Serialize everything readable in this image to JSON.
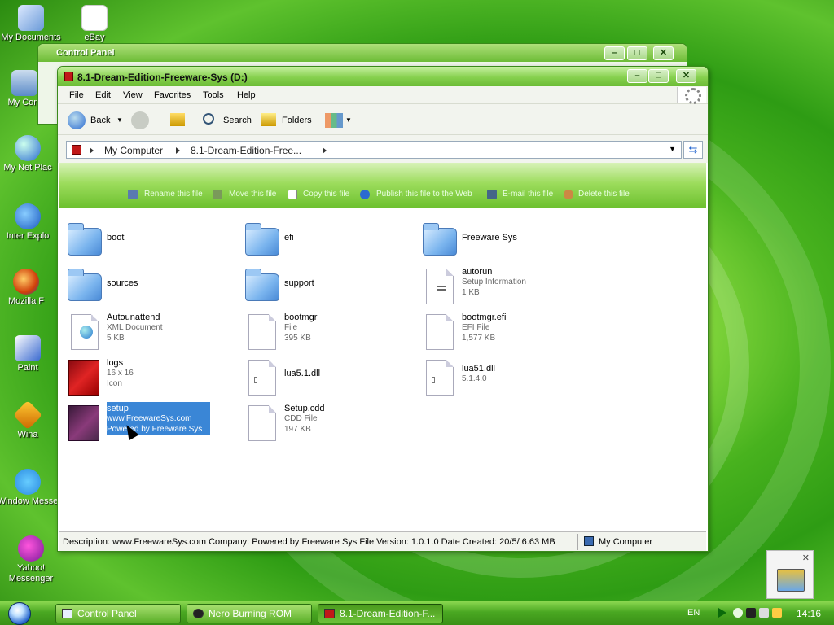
{
  "desktop": {
    "icons": [
      {
        "label": "My Documents"
      },
      {
        "label": "eBay"
      },
      {
        "label": "My Com"
      },
      {
        "label": "My Net Plac"
      },
      {
        "label": "Inter Explo"
      },
      {
        "label": "Mozilla F"
      },
      {
        "label": "Paint"
      },
      {
        "label": "Wina"
      },
      {
        "label": "Window Messe"
      },
      {
        "label": "Yahoo! Messenger"
      }
    ]
  },
  "back_window": {
    "title": "Control Panel"
  },
  "window": {
    "title": "8.1-Dream-Edition-Freeware-Sys (D:)",
    "caption": {
      "minimize": "0",
      "maximize": "1",
      "close": "r"
    },
    "menu": [
      "File",
      "Edit",
      "View",
      "Favorites",
      "Tools",
      "Help"
    ],
    "toolbar": {
      "back": "Back",
      "search": "Search",
      "folders": "Folders"
    },
    "address": {
      "crumbs": [
        "My Computer",
        "8.1-Dream-Edition-Free..."
      ]
    },
    "commands": [
      "Rename this file",
      "Move this file",
      "Copy this file",
      "Publish this file to the Web",
      "E-mail this file",
      "Delete this file"
    ],
    "files": [
      {
        "name": "boot",
        "kind": "folder"
      },
      {
        "name": "efi",
        "kind": "folder"
      },
      {
        "name": "Freeware Sys",
        "kind": "folder"
      },
      {
        "name": "sources",
        "kind": "folder"
      },
      {
        "name": "support",
        "kind": "folder"
      },
      {
        "name": "autorun",
        "line2": "Setup Information",
        "line3": "1 KB",
        "kind": "ini"
      },
      {
        "name": "Autounattend",
        "line2": "XML Document",
        "line3": "5 KB",
        "kind": "xml"
      },
      {
        "name": "bootmgr",
        "line2": "File",
        "line3": "395 KB",
        "kind": "doc"
      },
      {
        "name": "bootmgr.efi",
        "line2": "EFI File",
        "line3": "1,577 KB",
        "kind": "doc"
      },
      {
        "name": "logs",
        "line2": "16 x 16",
        "line3": "Icon",
        "kind": "logs"
      },
      {
        "name": "lua5.1.dll",
        "kind": "dll"
      },
      {
        "name": "lua51.dll",
        "line2": "5.1.4.0",
        "kind": "dll"
      },
      {
        "name": "setup",
        "line2": "www.FreewareSys.com",
        "line3": "Powered by Freeware Sys",
        "kind": "setup",
        "selected": true
      },
      {
        "name": "Setup.cdd",
        "line2": "CDD File",
        "line3": "197 KB",
        "kind": "doc"
      }
    ],
    "status": {
      "description": "Description: www.FreewareSys.com Company: Powered by Freeware Sys File Version: 1.0.1.0 Date Created: 20/5/ 6.63 MB",
      "location": "My Computer"
    }
  },
  "taskbar": {
    "tasks": [
      {
        "label": "Control Panel"
      },
      {
        "label": "Nero Burning ROM"
      },
      {
        "label": "8.1-Dream-Edition-F..."
      }
    ],
    "lang": "EN",
    "clock": "14:16"
  },
  "colors": {
    "accent": "#6cbc36",
    "selection": "#3a86d6"
  }
}
